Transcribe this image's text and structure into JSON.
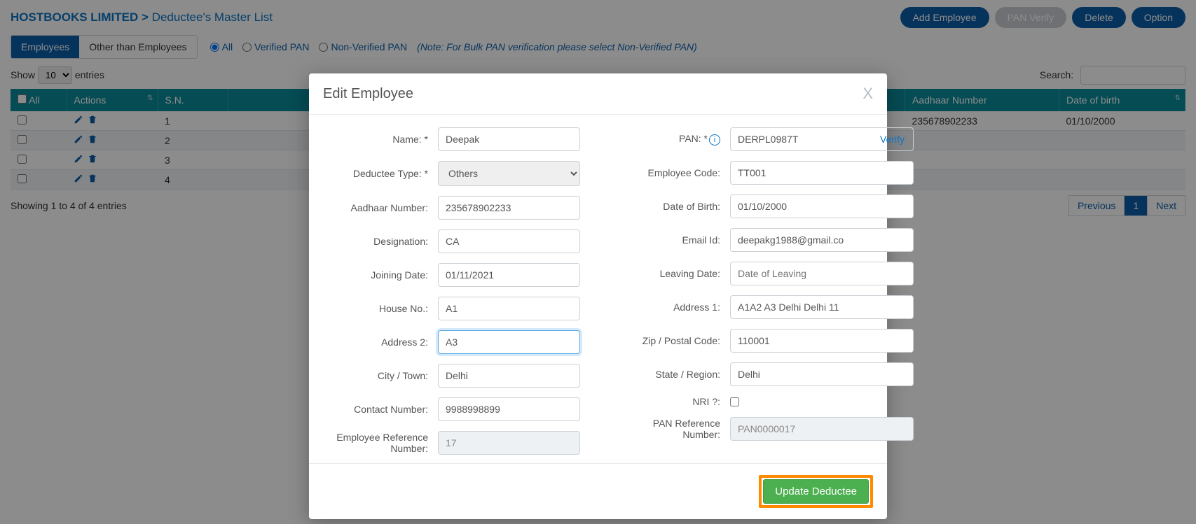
{
  "breadcrumb": {
    "company": "HOSTBOOKS LIMITED",
    "sep": ">",
    "page": "Deductee's Master List"
  },
  "topButtons": {
    "add": "Add Employee",
    "panVerify": "PAN Verify",
    "delete": "Delete",
    "option": "Option"
  },
  "tabs": {
    "employees": "Employees",
    "other": "Other than Employees"
  },
  "radios": {
    "all": "All",
    "verified": "Verified PAN",
    "nonverified": "Non-Verified PAN"
  },
  "note": "(Note: For Bulk PAN verification please select Non-Verified PAN)",
  "show": {
    "prefix": "Show",
    "value": "10",
    "suffix": "entries"
  },
  "search": {
    "label": "Search:"
  },
  "columns": {
    "all": "All",
    "actions": "Actions",
    "sn": "S.N.",
    "aadhaar": "Aadhaar Number",
    "dob": "Date of birth"
  },
  "rows": [
    {
      "sn": "1",
      "aadhaar": "235678902233",
      "dob": "01/10/2000"
    },
    {
      "sn": "2",
      "aadhaar": "",
      "dob": ""
    },
    {
      "sn": "3",
      "aadhaar": "",
      "dob": ""
    },
    {
      "sn": "4",
      "aadhaar": "",
      "dob": ""
    }
  ],
  "tableInfo": "Showing 1 to 4 of 4 entries",
  "pager": {
    "prev": "Previous",
    "p1": "1",
    "next": "Next"
  },
  "modal": {
    "title": "Edit Employee",
    "labels": {
      "name": "Name: *",
      "pan": "PAN: *",
      "deductee": "Deductee Type: *",
      "empcode": "Employee Code:",
      "aadhaar": "Aadhaar Number:",
      "dob": "Date of Birth:",
      "designation": "Designation:",
      "email": "Email Id:",
      "joining": "Joining Date:",
      "leaving": "Leaving Date:",
      "house": "House No.:",
      "addr1": "Address 1:",
      "addr2": "Address 2:",
      "zip": "Zip / Postal Code:",
      "city": "City / Town:",
      "state": "State / Region:",
      "contact": "Contact Number:",
      "nri": "NRI ?:",
      "empref": "Employee Reference Number:",
      "panref": "PAN Reference Number:"
    },
    "values": {
      "name": "Deepak",
      "pan": "DERPL0987T",
      "deductee": "Others",
      "empcode": "TT001",
      "aadhaar": "235678902233",
      "dob": "01/10/2000",
      "designation": "CA",
      "email": "deepakg1988@gmail.co",
      "joining": "01/11/2021",
      "leaving": "",
      "leavingPh": "Date of Leaving",
      "house": "A1",
      "addr1": "A1A2 A3 Delhi Delhi 11",
      "addr2": "A3",
      "zip": "110001",
      "city": "Delhi",
      "state": "Delhi",
      "contact": "9988998899",
      "empref": "17",
      "panref": "PAN0000017"
    },
    "verify": "Verify",
    "update": "Update Deductee"
  }
}
